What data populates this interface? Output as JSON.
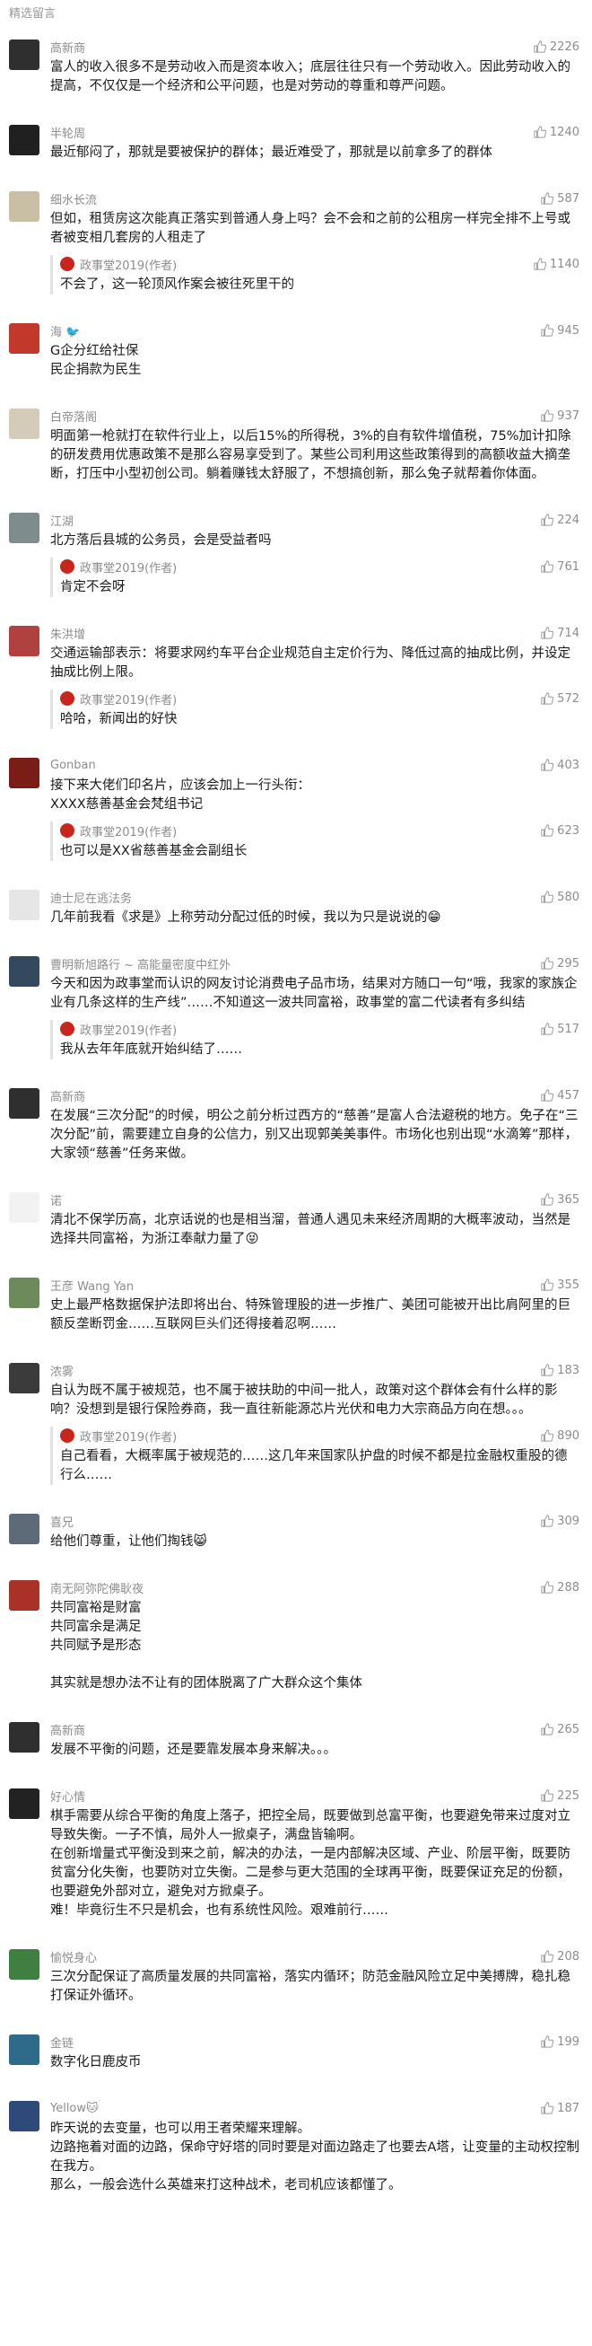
{
  "header": {
    "title": "精选留言"
  },
  "colors": {
    "reply_badge": "#c8261d",
    "meta_gray": "#8d8d8d"
  },
  "comments": [
    {
      "nickname": "高新商",
      "likes": "2226",
      "avatar": "#2f2f2f",
      "text": "富人的收入很多不是劳动收入而是资本收入；底层往往只有一个劳动收入。因此劳动收入的提高，不仅仅是一个经济和公平问题，也是对劳动的尊重和尊严问题。"
    },
    {
      "nickname": "半轮周",
      "likes": "1240",
      "avatar": "#202020",
      "text": "最近郁闷了，那就是要被保护的群体；最近难受了，那就是以前拿多了的群体"
    },
    {
      "nickname": "细水长流",
      "likes": "587",
      "avatar": "#c9bfa5",
      "text": "但如，租赁房这次能真正落实到普通人身上吗？会不会和之前的公租房一样完全排不上号或者被变相几套房的人租走了",
      "reply": {
        "author": "政事堂2019(作者)",
        "likes": "1140",
        "text": "不会了，这一轮顶风作案会被往死里干的"
      }
    },
    {
      "nickname": "海 🐦",
      "likes": "945",
      "avatar": "#c0392b",
      "text": "G企分红给社保\n民企捐款为民生"
    },
    {
      "nickname": "白帝落阁",
      "likes": "937",
      "avatar": "#d4cbb8",
      "text": "明面第一枪就打在软件行业上，以后15%的所得税，3%的自有软件增值税，75%加计扣除的研发费用优惠政策不是那么容易享受到了。某些公司利用这些政策得到的高额收益大摘垄断，打压中小型初创公司。躺着赚钱太舒服了，不想搞创新，那么兔子就帮着你体面。"
    },
    {
      "nickname": "江湖",
      "likes": "224",
      "avatar": "#7f8c8d",
      "text": "北方落后县城的公务员，会是受益者吗",
      "reply": {
        "author": "政事堂2019(作者)",
        "likes": "761",
        "text": "肯定不会呀"
      }
    },
    {
      "nickname": "朱洪增",
      "likes": "714",
      "avatar": "#b0413e",
      "text": "交通运输部表示：将要求网约车平台企业规范自主定价行为、降低过高的抽成比例，并设定抽成比例上限。",
      "reply": {
        "author": "政事堂2019(作者)",
        "likes": "572",
        "text": "哈哈，新闻出的好快"
      }
    },
    {
      "nickname": "Gonban",
      "likes": "403",
      "avatar": "#7a1d16",
      "text": "接下来大佬们印名片，应该会加上一行头衔：\nXXXX慈善基金会梵组书记",
      "reply": {
        "author": "政事堂2019(作者)",
        "likes": "623",
        "text": "也可以是XX省慈善基金会副组长"
      }
    },
    {
      "nickname": "迪士尼在逃法务",
      "likes": "580",
      "avatar": "#e6e6e6",
      "text": "几年前我看《求是》上称劳动分配过低的时候，我以为只是说说的😁"
    },
    {
      "nickname": "曹明新旭路行 ~ 高能量密度中红外",
      "likes": "295",
      "avatar": "#34495e",
      "text": "今天和因为政事堂而认识的网友讨论消费电子品市场，结果对方随口一句“哦，我家的家族企业有几条这样的生产线”……不知道这一波共同富裕，政事堂的富二代读者有多纠结",
      "reply": {
        "author": "政事堂2019(作者)",
        "likes": "517",
        "text": "我从去年年底就开始纠结了……"
      }
    },
    {
      "nickname": "高新商",
      "likes": "457",
      "avatar": "#2f2f2f",
      "text": "在发展“三次分配”的时候，明公之前分析过西方的“慈善”是富人合法避税的地方。免子在“三次分配”前，需要建立自身的公信力，别又出现郭美美事件。市场化也别出现“水滴筹”那样，大家领“慈善”任务来做。"
    },
    {
      "nickname": "诺",
      "likes": "365",
      "avatar": "#f2f2f2",
      "text": "清北不保学历高，北京话说的也是相当溜，普通人遇见未来经济周期的大概率波动，当然是选择共同富裕，为浙江奉献力量了😝"
    },
    {
      "nickname": "王彦 Wang Yan",
      "likes": "355",
      "avatar": "#6d8b5a",
      "text": "史上最严格数据保护法即将出台、特殊管理股的进一步推广、美团可能被开出比肩阿里的巨额反垄断罚金……互联网巨头们还得接着忍啊……"
    },
    {
      "nickname": "浓雾",
      "likes": "183",
      "avatar": "#3b3b3b",
      "text": "自认为既不属于被规范，也不属于被扶助的中间一批人，政策对这个群体会有什么样的影响？没想到是银行保险券商，我一直往新能源芯片光伏和电力大宗商品方向在想。。。",
      "reply": {
        "author": "政事堂2019(作者)",
        "likes": "890",
        "text": "自己看看，大概率属于被规范的……这几年来国家队护盘的时候不都是拉金融权重股的德行么……"
      }
    },
    {
      "nickname": "喜兄",
      "likes": "309",
      "avatar": "#5c6b77",
      "text": "给他们尊重，让他们掏钱😸"
    },
    {
      "nickname": "南无阿弥陀佛耿夜",
      "likes": "288",
      "avatar": "#a83228",
      "text": "共同富裕是财富\n共同富余是满足\n共同赋予是形态\n\n其实就是想办法不让有的团体脱离了广大群众这个集体"
    },
    {
      "nickname": "高新商",
      "likes": "265",
      "avatar": "#2f2f2f",
      "text": "发展不平衡的问题，还是要靠发展本身来解决。。。"
    },
    {
      "nickname": "好心情",
      "likes": "225",
      "avatar": "#222222",
      "text": "棋手需要从综合平衡的角度上落子，把控全局，既要做到总富平衡，也要避免带来过度对立导致失衡。一子不慎，局外人一掀桌子，满盘皆输啊。\n在创新增量式平衡没到来之前，解决的办法，一是内部解决区域、产业、阶层平衡，既要防贫富分化失衡，也要防对立失衡。二是参与更大范围的全球再平衡，既要保证充足的份额，也要避免外部对立，避免对方掀桌子。\n难！毕竟衍生不只是机会，也有系统性风险。艰难前行……"
    },
    {
      "nickname": "愉悦身心",
      "likes": "208",
      "avatar": "#3f7f3f",
      "text": "三次分配保证了高质量发展的共同富裕，落实内循环；防范金融风险立足中美搏牌，稳扎稳打保证外循环。"
    },
    {
      "nickname": "金链",
      "likes": "199",
      "avatar": "#2e6b8a",
      "text": "数字化日鹿皮币"
    },
    {
      "nickname": "Yellow🐱",
      "likes": "187",
      "avatar": "#2d4a7a",
      "text": "昨天说的去变量，也可以用王者荣耀来理解。\n边路拖着对面的边路，保命守好塔的同时要是对面边路走了也要去A塔，让变量的主动权控制在我方。\n那么，一般会选什么英雄来打这种战术，老司机应该都懂了。"
    }
  ]
}
